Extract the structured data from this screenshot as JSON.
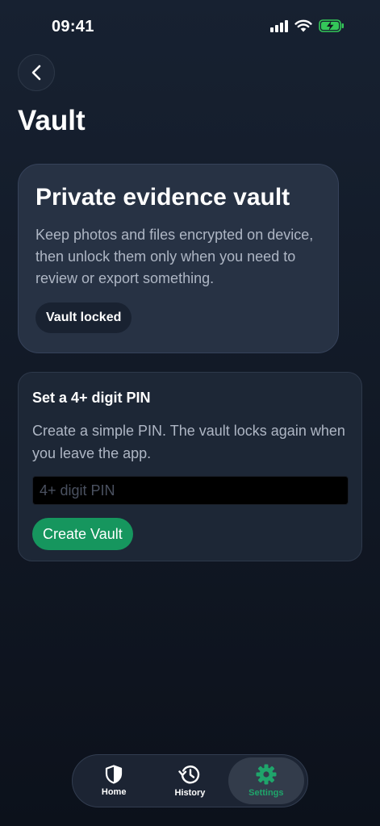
{
  "status_bar": {
    "time": "09:41",
    "icons": [
      "signal-icon",
      "wifi-icon",
      "battery-charging-icon"
    ]
  },
  "header": {
    "back_icon": "chevron-left-icon",
    "title": "Vault"
  },
  "hero_card": {
    "title": "Private evidence vault",
    "description": "Keep photos and files encrypted on device, then unlock them only when you need to review or export something.",
    "badge": "Vault locked"
  },
  "pin_card": {
    "title": "Set a 4+ digit PIN",
    "description": "Create a simple PIN. The vault locks again when you leave the app.",
    "input": {
      "value": "",
      "placeholder": "4+ digit PIN"
    },
    "button_label": "Create Vault"
  },
  "tab_bar": {
    "tabs": [
      {
        "label": "Home",
        "icon": "shield-icon",
        "active": false
      },
      {
        "label": "History",
        "icon": "history-icon",
        "active": false
      },
      {
        "label": "Settings",
        "icon": "gear-icon",
        "active": true
      }
    ]
  },
  "colors": {
    "accent_green": "#16965e",
    "active_tab_label": "#1fa56b",
    "background_top": "#172131",
    "card": "#273244",
    "text_muted": "#aeb6c4"
  }
}
